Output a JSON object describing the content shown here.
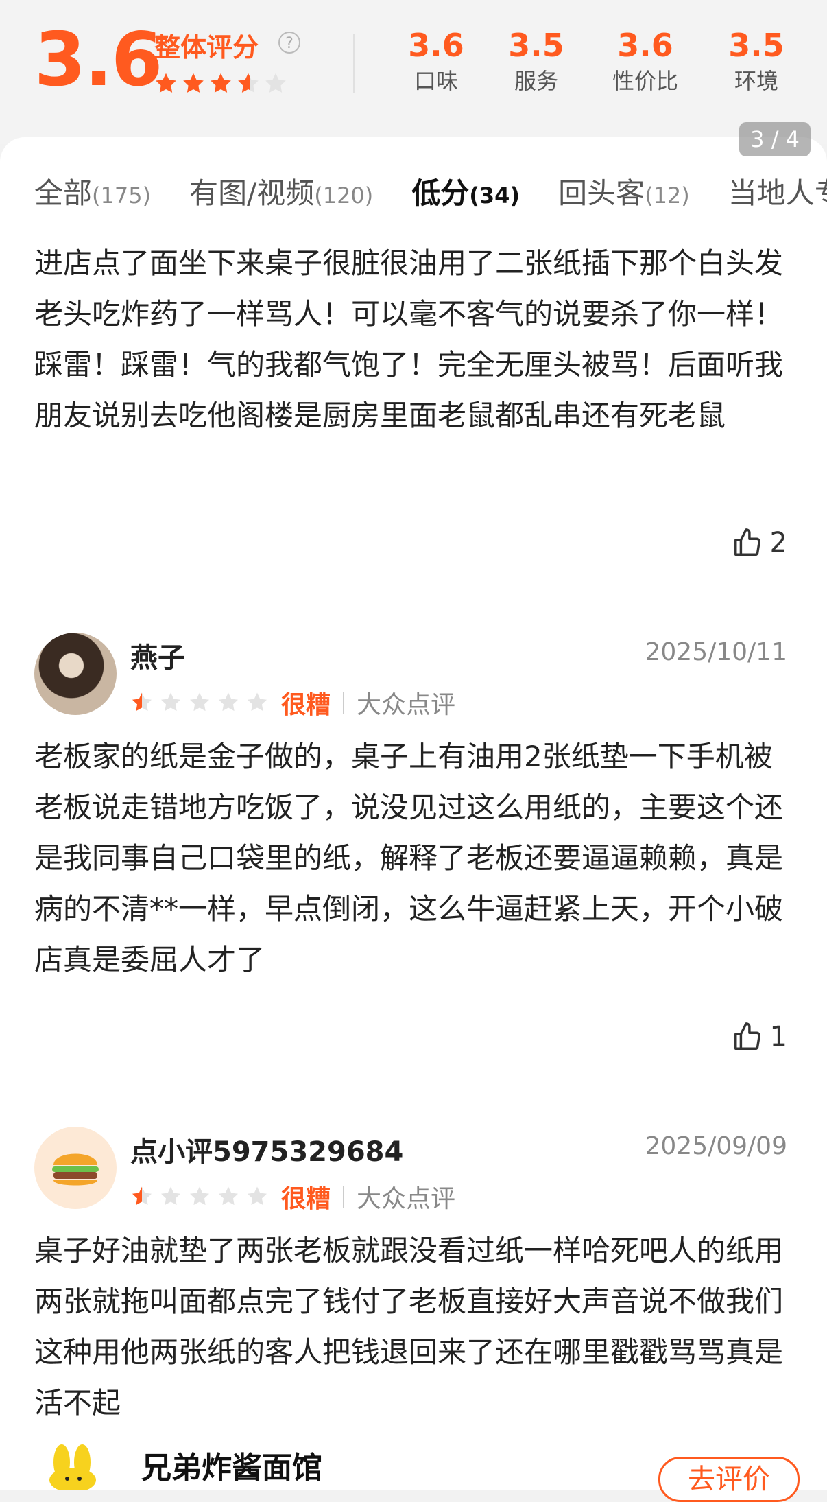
{
  "rating": {
    "overall_score": "3.6",
    "overall_label": "整体评分",
    "overall_stars": 3.6,
    "sub_scores": [
      {
        "value": "3.6",
        "label": "口味"
      },
      {
        "value": "3.5",
        "label": "服务"
      },
      {
        "value": "3.6",
        "label": "性价比"
      },
      {
        "value": "3.5",
        "label": "环境"
      }
    ]
  },
  "page_indicator": "3 / 4",
  "tabs": [
    {
      "label": "全部",
      "count": "(175)"
    },
    {
      "label": "有图/视频",
      "count": "(120)"
    },
    {
      "label": "低分",
      "count": "(34)",
      "active": true
    },
    {
      "label": "回头客",
      "count": "(12)"
    },
    {
      "label": "当地人专",
      "count": ""
    }
  ],
  "reviews": [
    {
      "text": "进店点了面坐下来桌子很脏很油用了二张纸插下那个白头发老头吃炸药了一样骂人！可以毫不客气的说要杀了你一样！踩雷！踩雷！气的我都气饱了！完全无厘头被骂！后面听我朋友说别去吃他阁楼是厨房里面老鼠都乱串还有死老鼠",
      "likes": "2"
    },
    {
      "username": "燕子",
      "date": "2025/10/11",
      "stars": 0.5,
      "rating_word": "很糟",
      "source": "大众点评",
      "text": "老板家的纸是金子做的，桌子上有油用2张纸垫一下手机被老板说走错地方吃饭了，说没见过这么用纸的，主要这个还是我同事自己口袋里的纸，解释了老板还要逼逼赖赖，真是病的不清**一样，早点倒闭，这么牛逼赶紧上天，开个小破店真是委屈人才了",
      "likes": "1"
    },
    {
      "username": "点小评5975329684",
      "date": "2025/09/09",
      "stars": 0.5,
      "rating_word": "很糟",
      "source": "大众点评",
      "text": "桌子好油就垫了两张老板就跟没看过纸一样哈死吧人的纸用两张就拖叫面都点完了钱付了老板直接好大声音说不做我们这种用他两张纸的客人把钱退回来了还在哪里戳戳骂骂真是活不起"
    }
  ],
  "bottom_bar": {
    "shop_name": "兄弟炸酱面馆",
    "action_label": "去评价"
  },
  "colors": {
    "accent": "#ff5a1f",
    "star_empty": "#e3e3e3"
  }
}
